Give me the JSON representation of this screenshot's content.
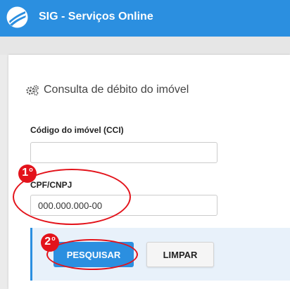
{
  "header": {
    "app_title": "SIG - Serviços Online",
    "brand_color": "#2b8fe0"
  },
  "form": {
    "title": "Consulta de débito do imóvel",
    "title_icon": "gears-icon",
    "cci_label": "Código do imóvel (CCI)",
    "cci_value": "",
    "cpf_label": "CPF/CNPJ",
    "cpf_value": "000.000.000-00"
  },
  "buttons": {
    "search_label": "PESQUISAR",
    "clear_label": "LIMPAR"
  },
  "annotations": {
    "step1": "1",
    "step2": "2",
    "ordinal": "o",
    "highlight_color": "#e3131b"
  }
}
